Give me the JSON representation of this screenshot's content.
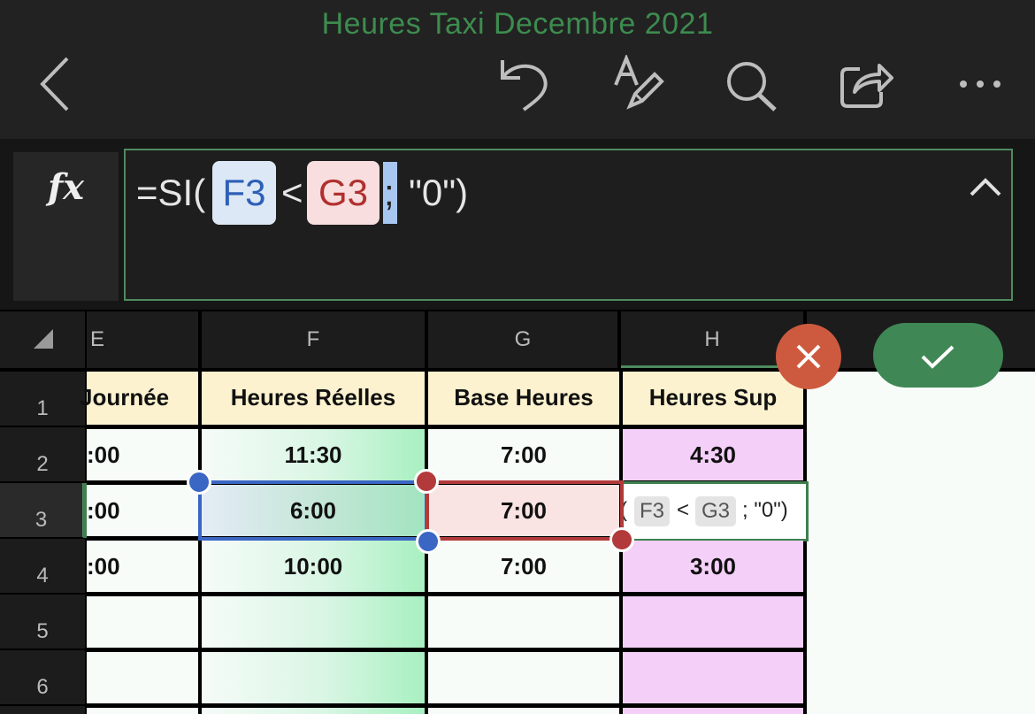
{
  "app": {
    "title": "Heures Taxi Decembre 2021"
  },
  "toolbar": {
    "icons": [
      "back-chevron-icon",
      "undo-icon",
      "text-format-icon",
      "search-icon",
      "share-icon",
      "more-icon"
    ]
  },
  "formula": {
    "fx_label": "fx",
    "prefix": "=SI(",
    "ref1": "F3",
    "op": "<",
    "ref2": "G3",
    "sep": ";",
    "suffix": "\"0\")"
  },
  "columns": [
    "E",
    "F",
    "G",
    "H"
  ],
  "rows": [
    "1",
    "2",
    "3",
    "4",
    "5",
    "6"
  ],
  "sheet": {
    "headers": {
      "E": "Journée",
      "F": "Heures Réelles",
      "G": "Base Heures",
      "H": "Heures Sup"
    },
    "r2": {
      "E": ":00",
      "F": "11:30",
      "G": "7:00",
      "H": "4:30"
    },
    "r3": {
      "E": ":00",
      "F": "6:00",
      "G": "7:00"
    },
    "r4": {
      "E": ":00",
      "F": "10:00",
      "G": "7:00",
      "H": "3:00"
    }
  },
  "inline_edit": {
    "open": "(",
    "ref1": "F3",
    "op": "<",
    "ref2": "G3",
    "rest": "; \"0\")"
  },
  "colors": {
    "title_green": "#3d8c4f",
    "ref1_blue": "#2d5fb6",
    "ref2_red": "#b03030",
    "cancel_red": "#cd5a3f",
    "confirm_green": "#3f8755",
    "header_yellow": "#fdf2cf",
    "col_h_pink": "#f4d0f9"
  }
}
